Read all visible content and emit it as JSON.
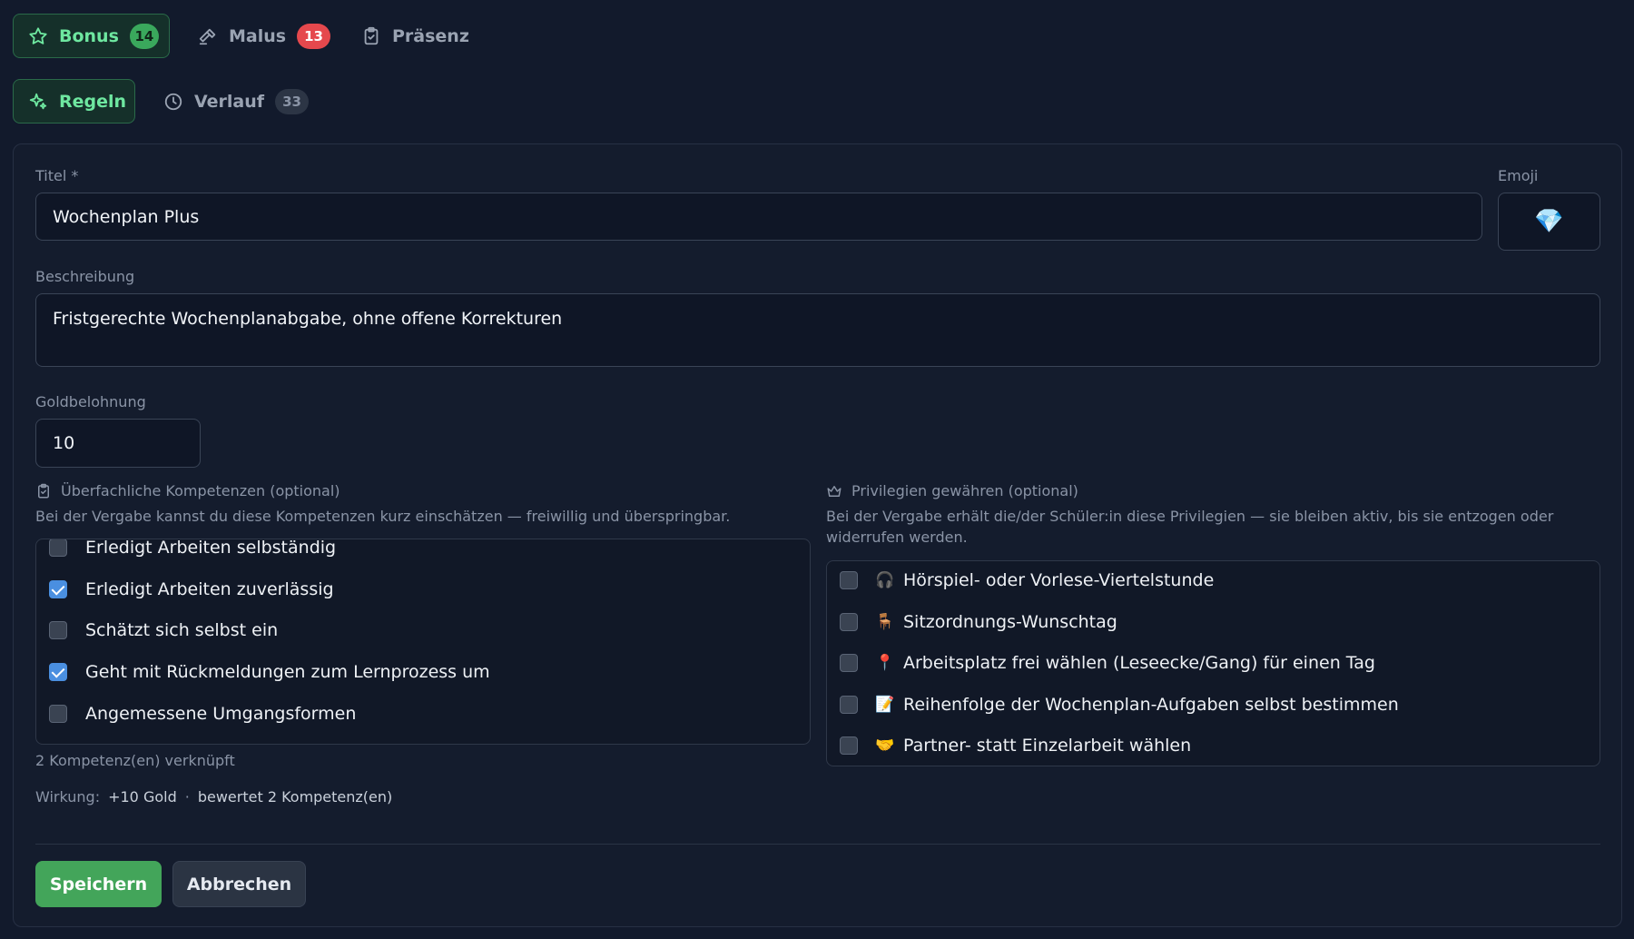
{
  "tabs_row1": [
    {
      "label": "Bonus",
      "badge": "14",
      "icon": "star-icon"
    },
    {
      "label": "Malus",
      "badge": "13",
      "icon": "hammer-icon"
    },
    {
      "label": "Präsenz",
      "icon": "clipboard-check-icon"
    }
  ],
  "tabs_row2": [
    {
      "label": "Regeln",
      "icon": "sparkles-icon"
    },
    {
      "label": "Verlauf",
      "badge": "33",
      "icon": "clock-icon"
    }
  ],
  "form": {
    "title_label": "Titel *",
    "title_value": "Wochenplan Plus",
    "emoji_label": "Emoji",
    "emoji_value": "💎",
    "description_label": "Beschreibung",
    "description_value": "Fristgerechte Wochenplanabgabe, ohne offene Korrekturen",
    "gold_label": "Goldbelohnung",
    "gold_value": "10"
  },
  "competencies": {
    "title": "Überfachliche Kompetenzen (optional)",
    "help": "Bei der Vergabe kannst du diese Kompetenzen kurz einschätzen — freiwillig und überspringbar.",
    "items": [
      {
        "label": "Erledigt Arbeiten selbständig",
        "checked": false
      },
      {
        "label": "Erledigt Arbeiten zuverlässig",
        "checked": true
      },
      {
        "label": "Schätzt sich selbst ein",
        "checked": false
      },
      {
        "label": "Geht mit Rückmeldungen zum Lernprozess um",
        "checked": true
      },
      {
        "label": "Angemessene Umgangsformen",
        "checked": false
      }
    ],
    "linked_count": "2 Kompetenz(en) verknüpft"
  },
  "effect": {
    "label": "Wirkung:",
    "gold": "+10 Gold",
    "separator": "·",
    "rated": "bewertet 2 Kompetenz(en)"
  },
  "privileges": {
    "title": "Privilegien gewähren (optional)",
    "help": "Bei der Vergabe erhält die/der Schüler:in diese Privilegien — sie bleiben aktiv, bis sie entzogen oder widerrufen werden.",
    "items": [
      {
        "emoji": "🎧",
        "label": "Hörspiel- oder Vorlese-Viertelstunde",
        "checked": false
      },
      {
        "emoji": "🪑",
        "label": "Sitzordnungs-Wunschtag",
        "checked": false
      },
      {
        "emoji": "📍",
        "label": "Arbeitsplatz frei wählen (Leseecke/Gang) für einen Tag",
        "checked": false
      },
      {
        "emoji": "📝",
        "label": "Reihenfolge der Wochenplan-Aufgaben selbst bestimmen",
        "checked": false
      },
      {
        "emoji": "🤝",
        "label": "Partner- statt Einzelarbeit wählen",
        "checked": false
      }
    ]
  },
  "actions": {
    "save": "Speichern",
    "cancel": "Abbrechen"
  },
  "colors": {
    "background": "#121a2c",
    "accent_green": "#6ee7a0",
    "primary_button": "#43a55a",
    "badge_red": "#e5484d",
    "checkbox_checked": "#4a8fe0"
  }
}
